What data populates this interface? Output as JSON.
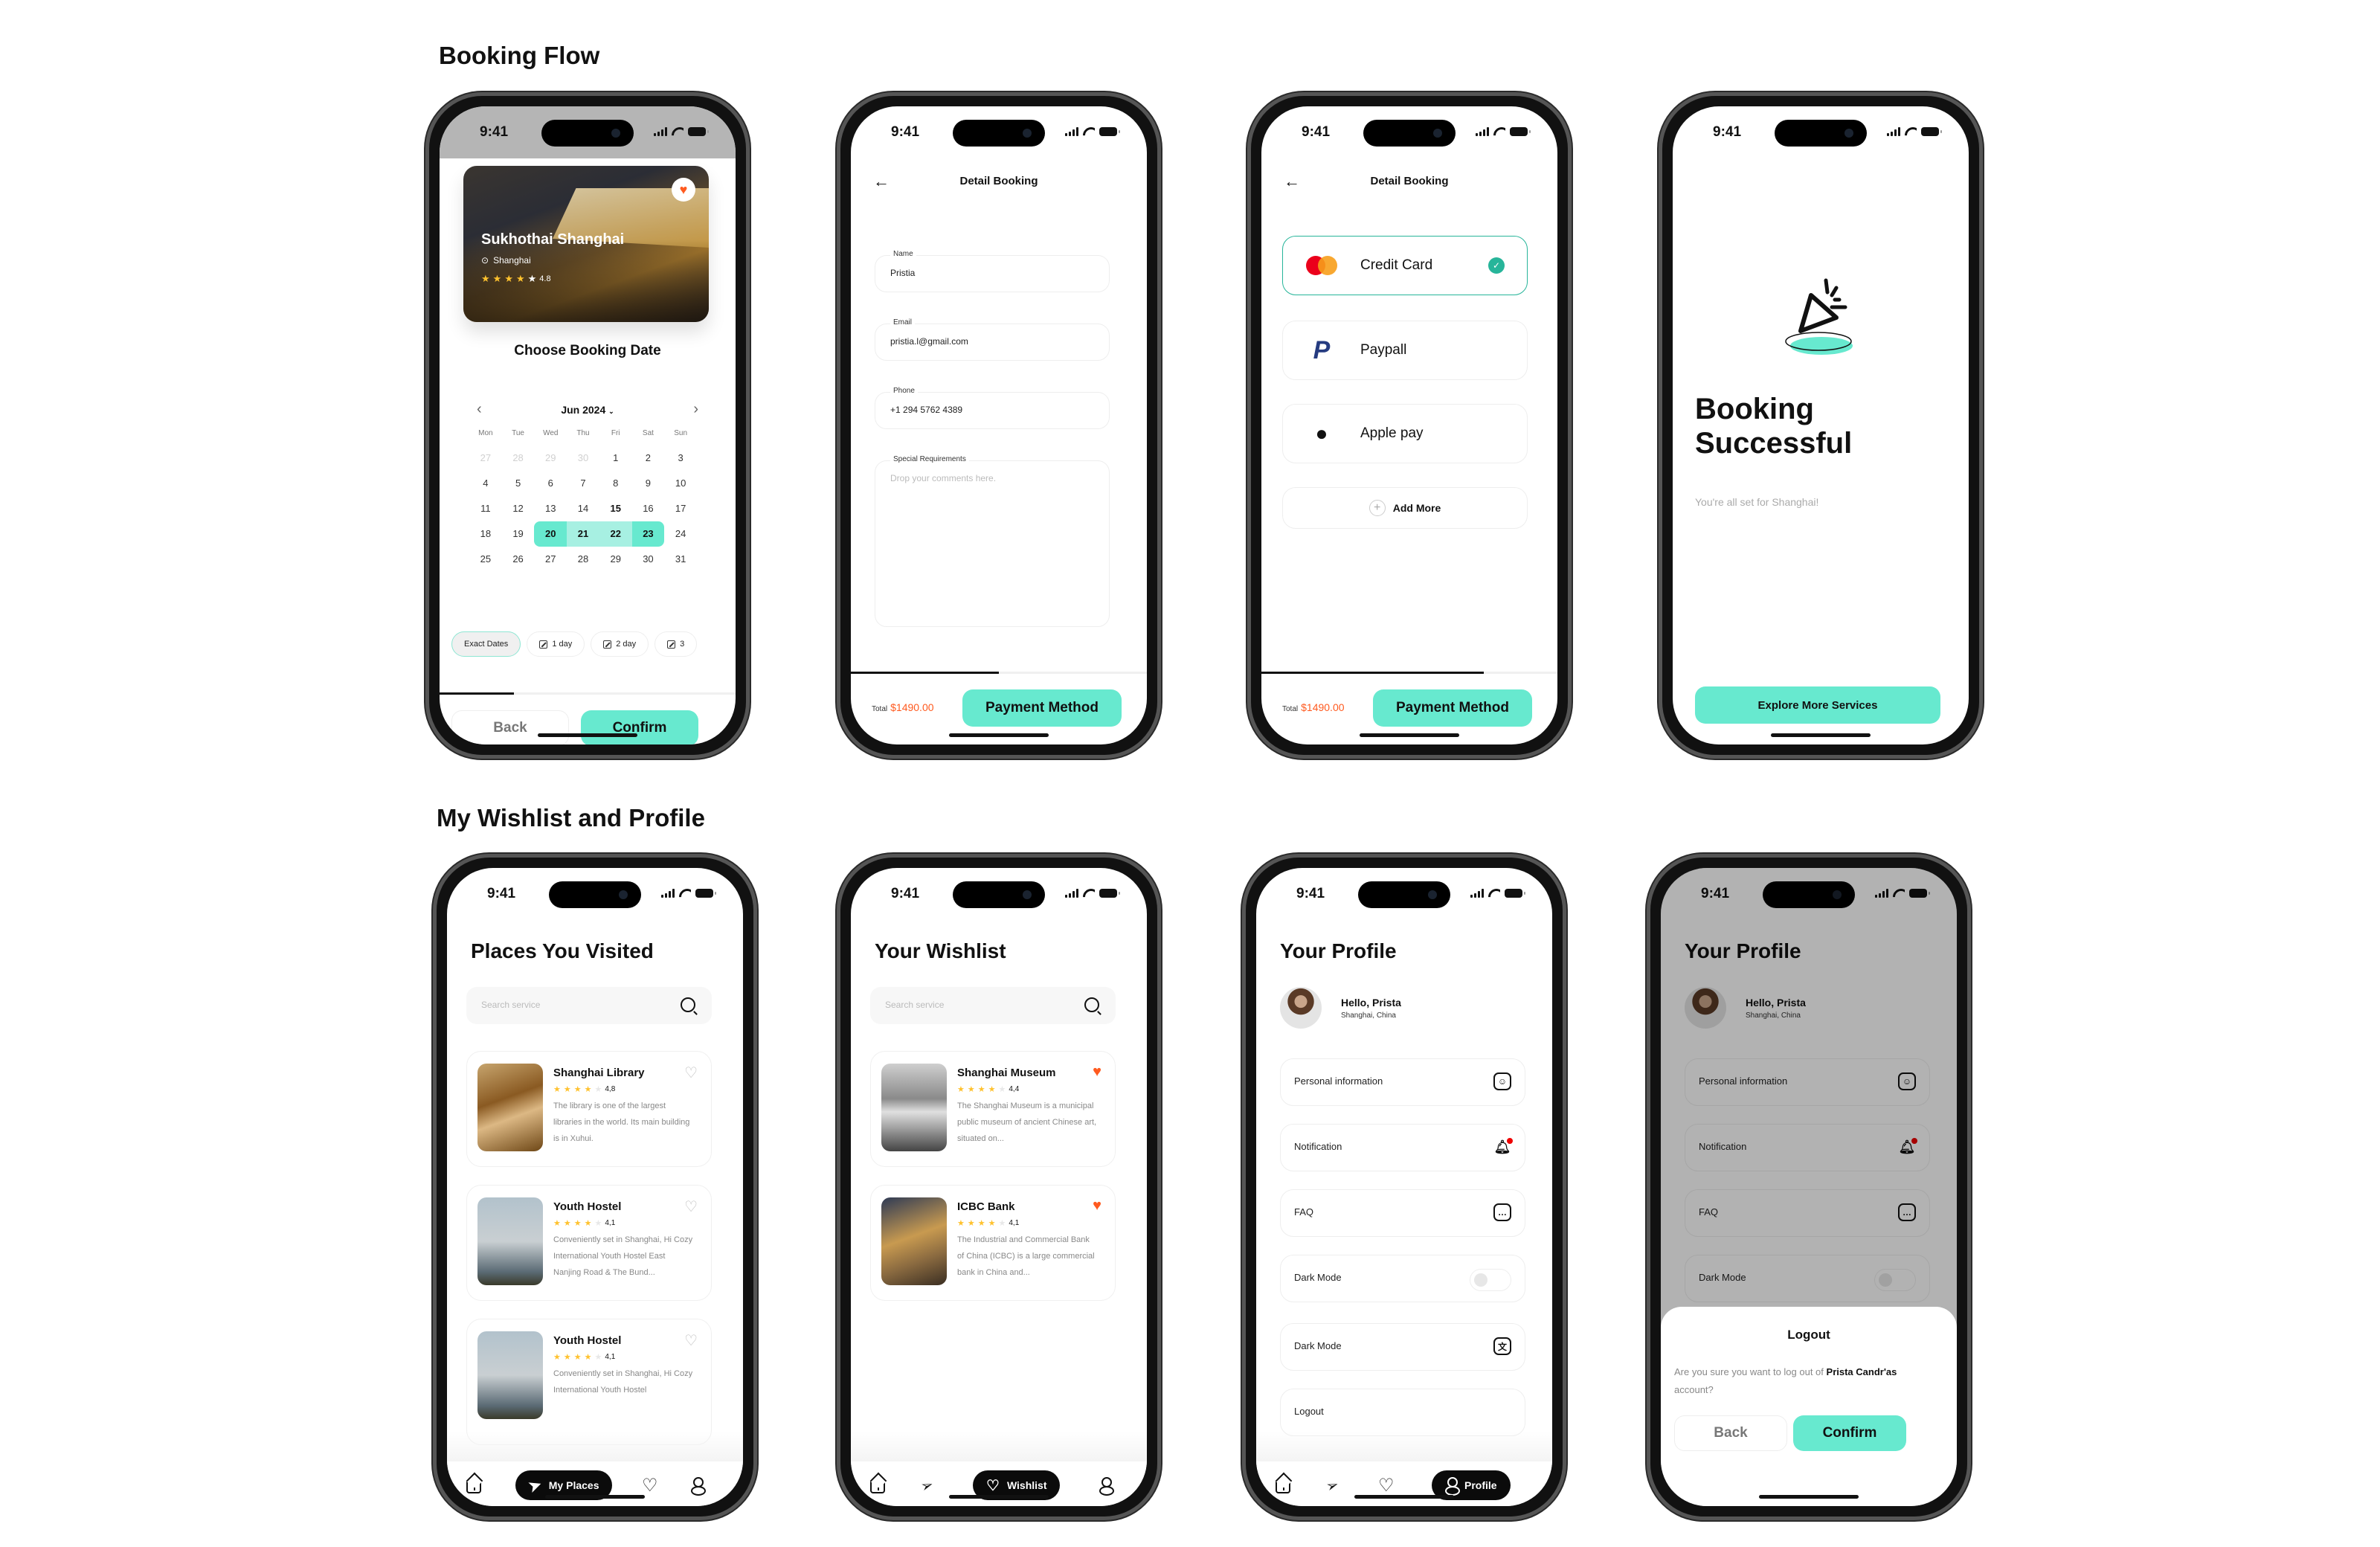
{
  "sections": {
    "booking_flow_title": "Booking Flow",
    "wishlist_profile_title": "My Wishlist and Profile"
  },
  "status_bar": {
    "time": "9:41"
  },
  "choose_date": {
    "hotel": {
      "name": "Sukhothai Shanghai",
      "location": "Shanghai",
      "rating": "4.8",
      "stars": 4,
      "favorite": true
    },
    "title": "Choose Booking Date",
    "month_label": "Jun 2024",
    "weekdays": [
      "Mon",
      "Tue",
      "Wed",
      "Thu",
      "Fri",
      "Sat",
      "Sun"
    ],
    "days": [
      {
        "d": "27",
        "s": "muted"
      },
      {
        "d": "28",
        "s": "muted"
      },
      {
        "d": "29",
        "s": "muted"
      },
      {
        "d": "30",
        "s": "muted"
      },
      {
        "d": "1"
      },
      {
        "d": "2"
      },
      {
        "d": "3"
      },
      {
        "d": "4"
      },
      {
        "d": "5"
      },
      {
        "d": "6"
      },
      {
        "d": "7"
      },
      {
        "d": "8"
      },
      {
        "d": "9"
      },
      {
        "d": "10"
      },
      {
        "d": "11"
      },
      {
        "d": "12"
      },
      {
        "d": "13"
      },
      {
        "d": "14"
      },
      {
        "d": "15",
        "s": "bold"
      },
      {
        "d": "16"
      },
      {
        "d": "17"
      },
      {
        "d": "18"
      },
      {
        "d": "19"
      },
      {
        "d": "20",
        "s": "sel first"
      },
      {
        "d": "21",
        "s": "range"
      },
      {
        "d": "22",
        "s": "range"
      },
      {
        "d": "23",
        "s": "sel last"
      },
      {
        "d": "24"
      },
      {
        "d": "25"
      },
      {
        "d": "26"
      },
      {
        "d": "27"
      },
      {
        "d": "28"
      },
      {
        "d": "29"
      },
      {
        "d": "30"
      },
      {
        "d": "31"
      }
    ],
    "chips": [
      "Exact Dates",
      "1 day",
      "2 day",
      "3"
    ],
    "progress": 0.25,
    "back_label": "Back",
    "confirm_label": "Confirm"
  },
  "detail_booking": {
    "title": "Detail Booking",
    "fields": [
      {
        "label": "Name",
        "value": "Pristia"
      },
      {
        "label": "Email",
        "value": "pristia.l@gmail.com"
      },
      {
        "label": "Phone",
        "value": "+1 294 5762 4389"
      }
    ],
    "special": {
      "label": "Special Requirements",
      "placeholder": "Drop your comments here."
    },
    "progress": 0.5,
    "total_label": "Total",
    "total_value": "$1490.00",
    "cta_label": "Payment Method"
  },
  "payment": {
    "title": "Detail Booking",
    "methods": [
      {
        "label": "Credit Card",
        "icon": "mastercard-icon",
        "selected": true
      },
      {
        "label": "Paypall",
        "icon": "paypal-icon",
        "selected": false
      },
      {
        "label": "Apple pay",
        "icon": "apple-icon",
        "selected": false
      }
    ],
    "add_more_label": "Add More",
    "progress": 0.75,
    "total_label": "Total",
    "total_value": "$1490.00",
    "cta_label": "Payment Method"
  },
  "success": {
    "title": "Booking Successful",
    "subtitle": "You're all set for Shanghai!",
    "cta_label": "Explore More Services"
  },
  "places": {
    "title": "Places You Visited",
    "search_placeholder": "Search service",
    "items": [
      {
        "name": "Shanghai Library",
        "rating": "4,8",
        "desc": "The library is one of the largest libraries in the world. Its main building is in Xuhui.",
        "fav": false
      },
      {
        "name": "Youth Hostel",
        "rating": "4,1",
        "desc": "Conveniently set in Shanghai, Hi Cozy International Youth Hostel East Nanjing Road & The Bund...",
        "fav": false
      },
      {
        "name": "Youth Hostel",
        "rating": "4,1",
        "desc": "Conveniently set in Shanghai, Hi Cozy International Youth Hostel",
        "fav": false
      }
    ],
    "active_tab": "My Places"
  },
  "wishlist": {
    "title": "Your Wishlist",
    "search_placeholder": "Search service",
    "items": [
      {
        "name": "Shanghai Museum",
        "rating": "4,4",
        "desc": "The Shanghai Museum is a municipal public museum of ancient Chinese art, situated on...",
        "fav": true
      },
      {
        "name": "ICBC Bank",
        "rating": "4,1",
        "desc": "The Industrial and Commercial Bank of China (ICBC) is a large commercial bank in China and...",
        "fav": true
      }
    ],
    "active_tab": "Wishlist"
  },
  "profile": {
    "title": "Your Profile",
    "greeting": "Hello, Prista",
    "location": "Shanghai, China",
    "rows": [
      "Personal information",
      "Notification",
      "FAQ",
      "Dark Mode",
      "Dark Mode",
      "Logout"
    ],
    "dark_mode_on": false,
    "active_tab": "Profile"
  },
  "logout_sheet": {
    "title": "Logout",
    "message_prefix": "Are you sure you want to log out of",
    "account_name": "Prista Candr'as",
    "message_suffix": "account?",
    "back_label": "Back",
    "confirm_label": "Confirm"
  }
}
